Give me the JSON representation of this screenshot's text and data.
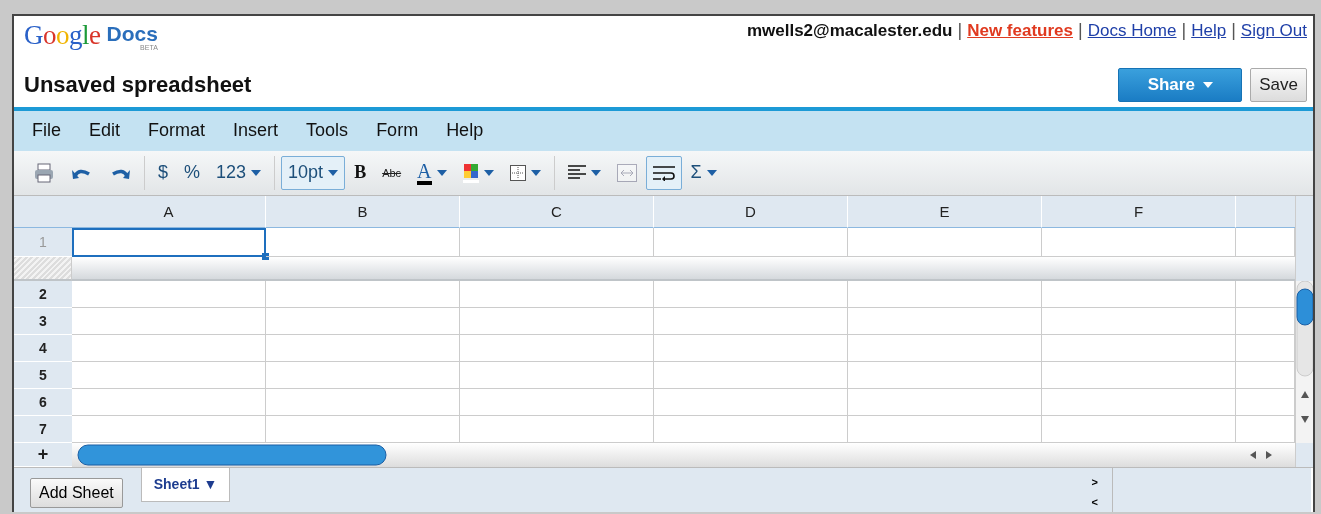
{
  "logo": {
    "word": "Google",
    "product": "Docs",
    "badge": "BETA"
  },
  "account": {
    "email": "mwells2@macalester.edu",
    "links": [
      {
        "label": "New features",
        "kind": "highlight"
      },
      {
        "label": "Docs Home",
        "kind": "plain"
      },
      {
        "label": "Help",
        "kind": "plain"
      },
      {
        "label": "Sign Out",
        "kind": "plain"
      }
    ],
    "separator": "|"
  },
  "document": {
    "title": "Unsaved spreadsheet"
  },
  "actions": [
    {
      "label": "Share",
      "kind": "primary",
      "dropdown": true
    },
    {
      "label": "Save",
      "kind": "plain",
      "dropdown": false
    }
  ],
  "menu": [
    "File",
    "Edit",
    "Format",
    "Insert",
    "Tools",
    "Form",
    "Help"
  ],
  "toolbar": [
    [
      {
        "kind": "print",
        "dropdown": false,
        "selected": false,
        "disabled": false
      },
      {
        "kind": "undo",
        "dropdown": false,
        "selected": false,
        "disabled": false
      },
      {
        "kind": "redo",
        "dropdown": false,
        "selected": false,
        "disabled": false
      }
    ],
    [
      {
        "kind": "text",
        "label": "$",
        "dropdown": false,
        "selected": false,
        "disabled": false
      },
      {
        "kind": "text",
        "label": "%",
        "dropdown": false,
        "selected": false,
        "disabled": false
      },
      {
        "kind": "text",
        "label": "123",
        "dropdown": true,
        "selected": false,
        "disabled": false
      }
    ],
    [
      {
        "kind": "text",
        "label": "10pt",
        "dropdown": true,
        "selected": true,
        "disabled": false
      },
      {
        "kind": "bold",
        "label": "B",
        "dropdown": false,
        "selected": false,
        "disabled": false
      },
      {
        "kind": "strike",
        "label": "Abc",
        "dropdown": false,
        "selected": false,
        "disabled": false
      },
      {
        "kind": "textcolor",
        "label": "A",
        "dropdown": true,
        "selected": false,
        "disabled": false
      },
      {
        "kind": "fill",
        "dropdown": true,
        "selected": false,
        "disabled": false
      },
      {
        "kind": "borders",
        "dropdown": true,
        "selected": false,
        "disabled": false
      }
    ],
    [
      {
        "kind": "align",
        "dropdown": true,
        "selected": false,
        "disabled": false
      },
      {
        "kind": "merge",
        "dropdown": false,
        "selected": false,
        "disabled": true
      },
      {
        "kind": "wrap",
        "dropdown": false,
        "selected": true,
        "disabled": false
      },
      {
        "kind": "text",
        "label": "Σ",
        "dropdown": true,
        "selected": false,
        "disabled": false
      }
    ]
  ],
  "grid": {
    "columns": [
      "A",
      "B",
      "C",
      "D",
      "E",
      "F"
    ],
    "rows": [
      {
        "label": "1",
        "frozen": true,
        "cells": [
          {
            "selected": true
          },
          {
            "selected": false
          },
          {
            "selected": false
          },
          {
            "selected": false
          },
          {
            "selected": false
          },
          {
            "selected": false
          },
          {
            "selected": false
          }
        ]
      },
      {
        "label": "2",
        "frozen": false,
        "cells": [
          {
            "selected": false
          },
          {
            "selected": false
          },
          {
            "selected": false
          },
          {
            "selected": false
          },
          {
            "selected": false
          },
          {
            "selected": false
          },
          {
            "selected": false
          }
        ]
      },
      {
        "label": "3",
        "frozen": false,
        "cells": [
          {
            "selected": false
          },
          {
            "selected": false
          },
          {
            "selected": false
          },
          {
            "selected": false
          },
          {
            "selected": false
          },
          {
            "selected": false
          },
          {
            "selected": false
          }
        ]
      },
      {
        "label": "4",
        "frozen": false,
        "cells": [
          {
            "selected": false
          },
          {
            "selected": false
          },
          {
            "selected": false
          },
          {
            "selected": false
          },
          {
            "selected": false
          },
          {
            "selected": false
          },
          {
            "selected": false
          }
        ]
      },
      {
        "label": "5",
        "frozen": false,
        "cells": [
          {
            "selected": false
          },
          {
            "selected": false
          },
          {
            "selected": false
          },
          {
            "selected": false
          },
          {
            "selected": false
          },
          {
            "selected": false
          },
          {
            "selected": false
          }
        ]
      },
      {
        "label": "6",
        "frozen": false,
        "cells": [
          {
            "selected": false
          },
          {
            "selected": false
          },
          {
            "selected": false
          },
          {
            "selected": false
          },
          {
            "selected": false
          },
          {
            "selected": false
          },
          {
            "selected": false
          }
        ]
      },
      {
        "label": "7",
        "frozen": false,
        "cells": [
          {
            "selected": false
          },
          {
            "selected": false
          },
          {
            "selected": false
          },
          {
            "selected": false
          },
          {
            "selected": false
          },
          {
            "selected": false
          },
          {
            "selected": false
          }
        ]
      }
    ],
    "add_row": "+"
  },
  "footer": {
    "add_sheet": "Add Sheet",
    "sheets": [
      {
        "label": "Sheet1 ▼",
        "selected": true
      }
    ],
    "scroll_right": ">",
    "scroll_left": "<"
  }
}
